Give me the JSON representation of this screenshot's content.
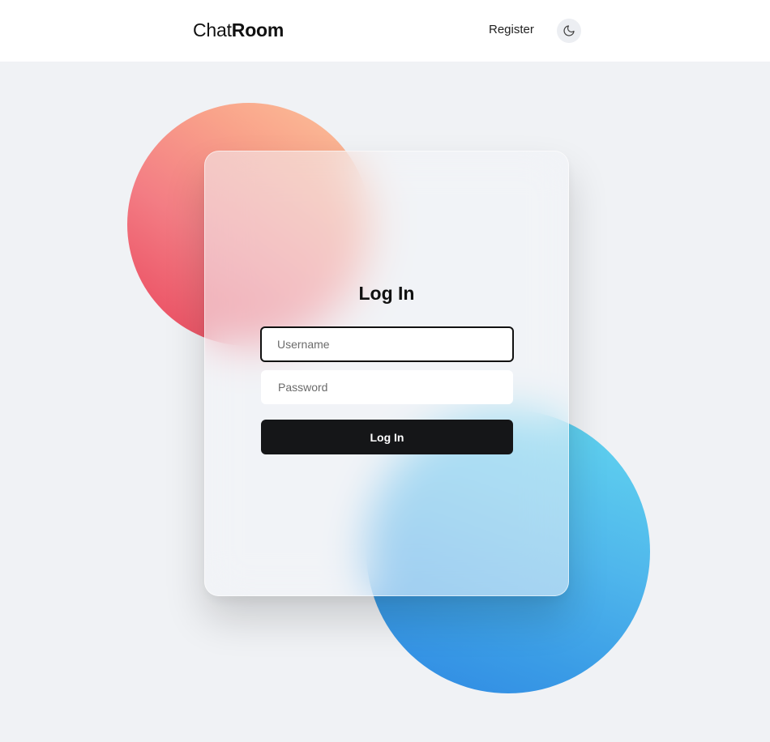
{
  "header": {
    "brand_part1": "Chat",
    "brand_part2": "Room",
    "register_label": "Register",
    "theme_toggle_icon": "moon-icon"
  },
  "login": {
    "title": "Log In",
    "username_placeholder": "Username",
    "username_value": "",
    "password_placeholder": "Password",
    "password_value": "",
    "submit_label": "Log In"
  },
  "colors": {
    "accent_dark": "#151618",
    "background": "#f0f2f5",
    "blob_warm_start": "#e9435a",
    "blob_warm_end": "#fcc49a",
    "blob_cool_start": "#63d7ef",
    "blob_cool_end": "#2f88e3"
  }
}
